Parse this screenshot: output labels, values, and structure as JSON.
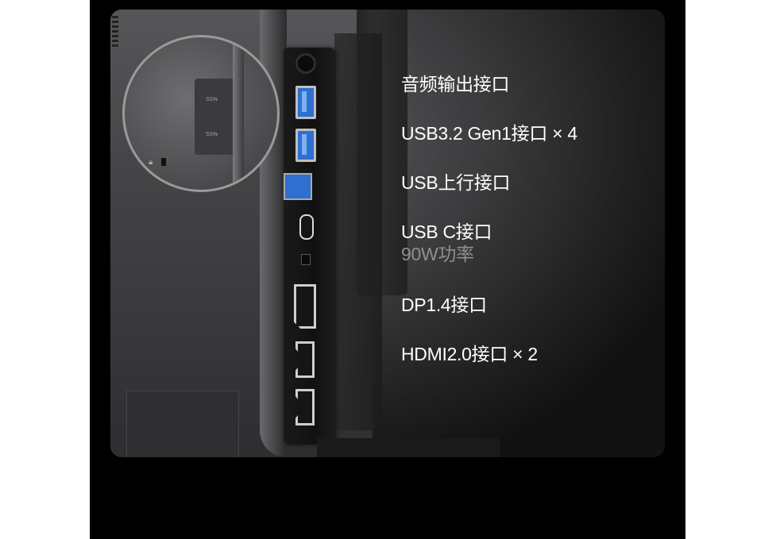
{
  "features": [
    {
      "label": "音频输出接口"
    },
    {
      "label": "USB3.2 Gen1接口 × 4"
    },
    {
      "label": "USB上行接口"
    },
    {
      "label": "USB C接口",
      "sub": "90W功率"
    },
    {
      "label": "DP1.4接口"
    },
    {
      "label": "HDMI2.0接口 × 2"
    }
  ],
  "colors": {
    "background": "#000000",
    "card": "#2e2e30",
    "text": "#ffffff",
    "subtext": "#8f8f91",
    "usb_blue": "#2f6fd0"
  },
  "icons": [
    "audio-jack-icon",
    "usb-a-port-icon",
    "usb-b-port-icon",
    "usb-c-port-icon",
    "dp-port-icon",
    "hdmi-port-icon",
    "kensington-lock-icon"
  ]
}
